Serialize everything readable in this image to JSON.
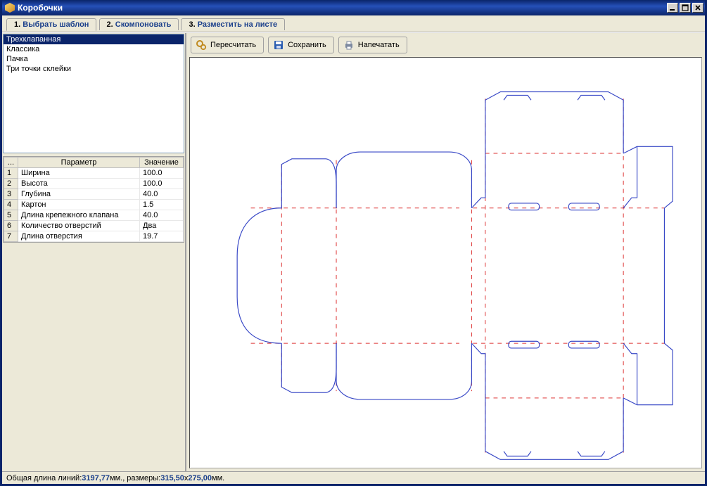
{
  "window": {
    "title": "Коробочки"
  },
  "tabs": [
    {
      "num": "1.",
      "label": "Выбрать шаблон"
    },
    {
      "num": "2.",
      "label": "Скомпоновать"
    },
    {
      "num": "3.",
      "label": "Разместить на листе"
    }
  ],
  "templates": [
    "Трехклапанная",
    "Классика",
    "Пачка",
    "Три точки склейки"
  ],
  "param_header": {
    "corner": "...",
    "param": "Параметр",
    "value": "Значение"
  },
  "params": [
    {
      "n": "1",
      "name": "Ширина",
      "value": "100.0"
    },
    {
      "n": "2",
      "name": "Высота",
      "value": "100.0"
    },
    {
      "n": "3",
      "name": "Глубина",
      "value": "40.0"
    },
    {
      "n": "4",
      "name": "Картон",
      "value": "1.5"
    },
    {
      "n": "5",
      "name": "Длина крепежного клапана",
      "value": "40.0"
    },
    {
      "n": "6",
      "name": "Количество отверстий",
      "value": "Два"
    },
    {
      "n": "7",
      "name": "Длина отверстия",
      "value": "19.7"
    }
  ],
  "toolbar": {
    "recalc": "Пересчитать",
    "save": "Сохранить",
    "print": "Напечатать"
  },
  "status": {
    "prefix": "Общая длина линий: ",
    "lines": "3197,77",
    "mid": " мм., размеры: ",
    "w": "315,50",
    "x": " x ",
    "h": "275,00",
    "suffix": " мм."
  }
}
